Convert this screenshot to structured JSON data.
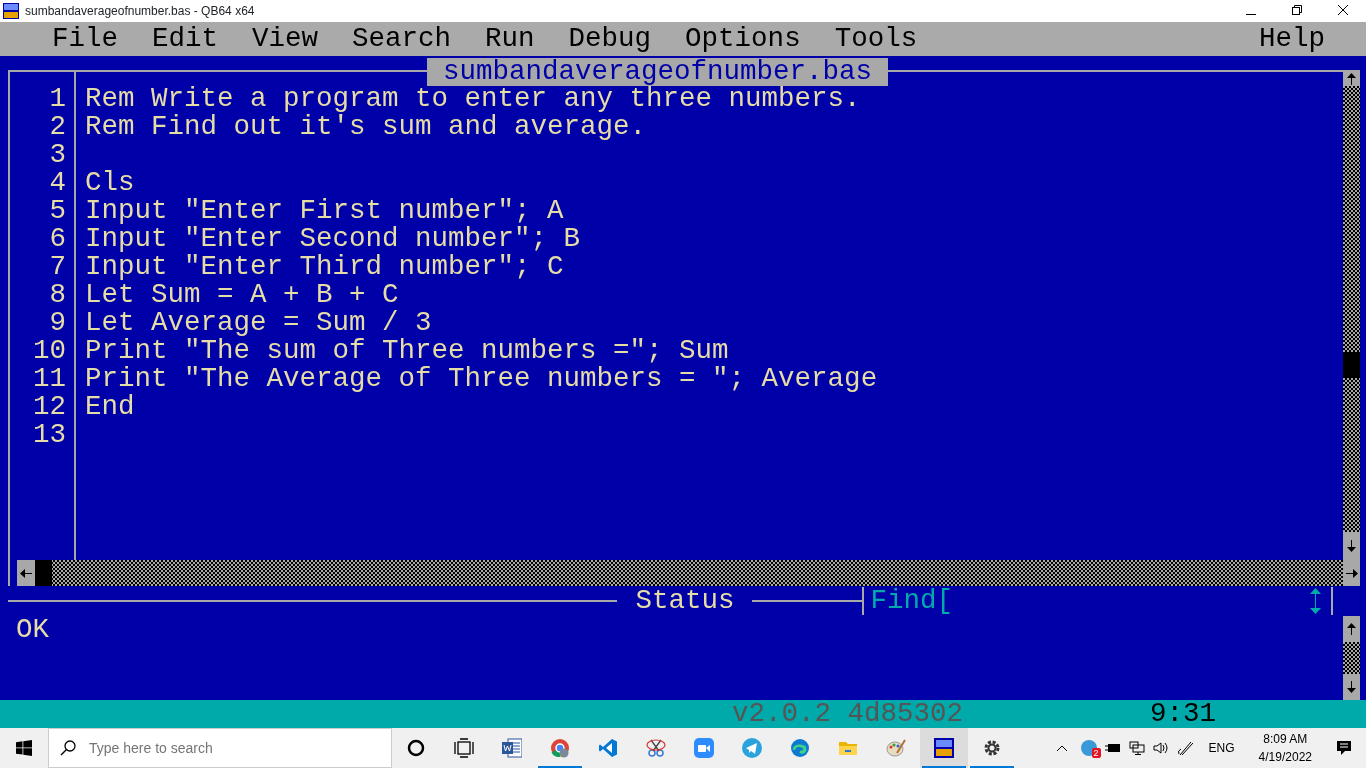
{
  "window": {
    "title": "sumbandaverageofnumber.bas - QB64 x64"
  },
  "menu_left": [
    "File",
    "Edit",
    "View",
    "Search",
    "Run",
    "Debug",
    "Options",
    "Tools"
  ],
  "menu_right": [
    "Help"
  ],
  "editor": {
    "filename": "sumbandaverageofnumber.bas",
    "lines": [
      {
        "number": "1",
        "text": "Rem Write a program to enter any three numbers."
      },
      {
        "number": "2",
        "text": "Rem Find out it's sum and average."
      },
      {
        "number": "3"
      },
      {
        "number": "4",
        "text": "Cls"
      },
      {
        "number": "5",
        "text": "Input \"Enter First number\"; A"
      },
      {
        "number": "6",
        "text": "Input \"Enter Second number\"; B"
      },
      {
        "number": "7",
        "text": "Input \"Enter Third number\"; C"
      },
      {
        "number": "8",
        "text": "Let Sum = A + B + C"
      },
      {
        "number": "9",
        "text": "Let Average = Sum / 3"
      },
      {
        "number": "10",
        "text": "Print \"The sum of Three numbers =\"; Sum"
      },
      {
        "number": "11",
        "text": "Print \"The Average of Three numbers = \"; Average"
      },
      {
        "number": "12",
        "text": "End"
      },
      {
        "number": "13"
      }
    ]
  },
  "status": {
    "title": "Status",
    "find_label": "Find[",
    "message": "OK"
  },
  "bottom_bar": {
    "version": "v2.0.2 4d85302",
    "position": "9:31"
  },
  "taskbar": {
    "search_placeholder": "Type here to search",
    "apps": [
      {
        "kind": "cortana",
        "running": false,
        "active": false
      },
      {
        "kind": "taskview",
        "running": false,
        "active": false
      },
      {
        "kind": "word",
        "running": false,
        "active": false
      },
      {
        "kind": "chrome",
        "running": true,
        "active": false
      },
      {
        "kind": "vscode",
        "running": false,
        "active": false
      },
      {
        "kind": "snip",
        "running": false,
        "active": false
      },
      {
        "kind": "zoom",
        "running": false,
        "active": false
      },
      {
        "kind": "telegram",
        "running": false,
        "active": false
      },
      {
        "kind": "edge",
        "running": false,
        "active": false
      },
      {
        "kind": "explorer",
        "running": false,
        "active": false
      },
      {
        "kind": "paint",
        "running": false,
        "active": false
      },
      {
        "kind": "qb64",
        "running": true,
        "active": true
      },
      {
        "kind": "settings",
        "running": true,
        "active": false
      }
    ],
    "tray_badge": "2",
    "language": "ENG",
    "time": "8:09 AM",
    "date": "4/19/2022"
  }
}
